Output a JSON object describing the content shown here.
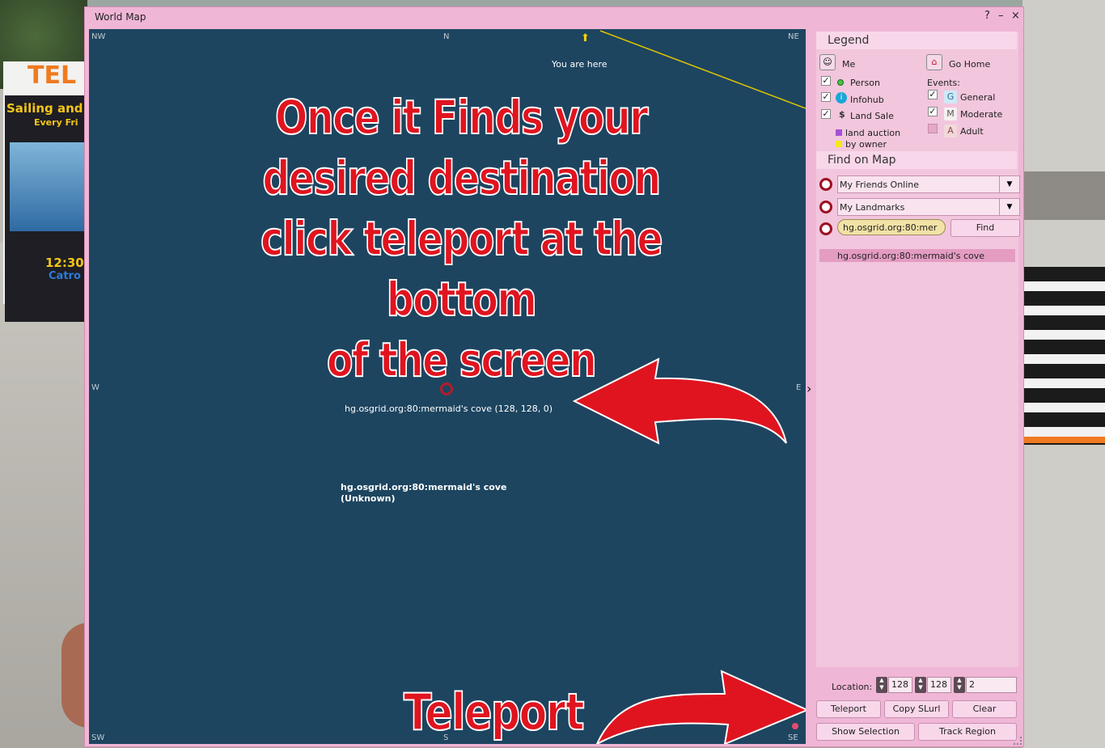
{
  "window": {
    "title": "World Map",
    "help": "?",
    "minimize": "–",
    "close": "×"
  },
  "map": {
    "directions": {
      "nw": "NW",
      "n": "N",
      "ne": "NE",
      "w": "W",
      "e": "E",
      "sw": "SW",
      "s": "S",
      "se": "SE"
    },
    "you_are_here": "You are here",
    "target_label": "hg.osgrid.org:80:mermaid's cove (128, 128, 0)",
    "region_name": "hg.osgrid.org:80:mermaid's cove",
    "region_status": "(Unknown)",
    "annotation_lines": [
      "Once it Finds your",
      "desired destination",
      "click teleport at the bottom",
      "of the screen"
    ],
    "annotation_teleport": "Teleport"
  },
  "legend": {
    "header": "Legend",
    "me": "Me",
    "go_home": "Go Home",
    "person": "Person",
    "infohub": "Infohub",
    "land_sale": "Land Sale",
    "land_auction": "land auction",
    "by_owner": "by owner",
    "events_label": "Events:",
    "general_letter": "G",
    "general": "General",
    "moderate_letter": "M",
    "moderate": "Moderate",
    "adult_letter": "A",
    "adult": "Adult",
    "checks": {
      "person": true,
      "infohub": true,
      "land_sale": true,
      "general": true,
      "moderate": true,
      "adult": false
    }
  },
  "find": {
    "header": "Find on Map",
    "friends_combo": "My Friends Online",
    "landmarks_combo": "My Landmarks",
    "search_value": "hg.osgrid.org:80:mer",
    "find_button": "Find",
    "result_item": "hg.osgrid.org:80:mermaid's cove"
  },
  "location": {
    "label": "Location:",
    "x": "128",
    "y": "128",
    "z": "2"
  },
  "buttons": {
    "teleport": "Teleport",
    "copy_slurl": "Copy SLurl",
    "clear": "Clear",
    "show_selection": "Show Selection",
    "track_region": "Track Region"
  },
  "background": {
    "poster_brand": "TEL",
    "poster_line1": "Sailing and",
    "poster_line2": "Every Fri",
    "poster_time": "12:30",
    "poster_sub": "Catro"
  },
  "colors": {
    "map_bg": "#1d4560",
    "window_bg": "#f0b6d6",
    "annotation_red": "#e0141f",
    "you_arrow": "#ffd400"
  }
}
